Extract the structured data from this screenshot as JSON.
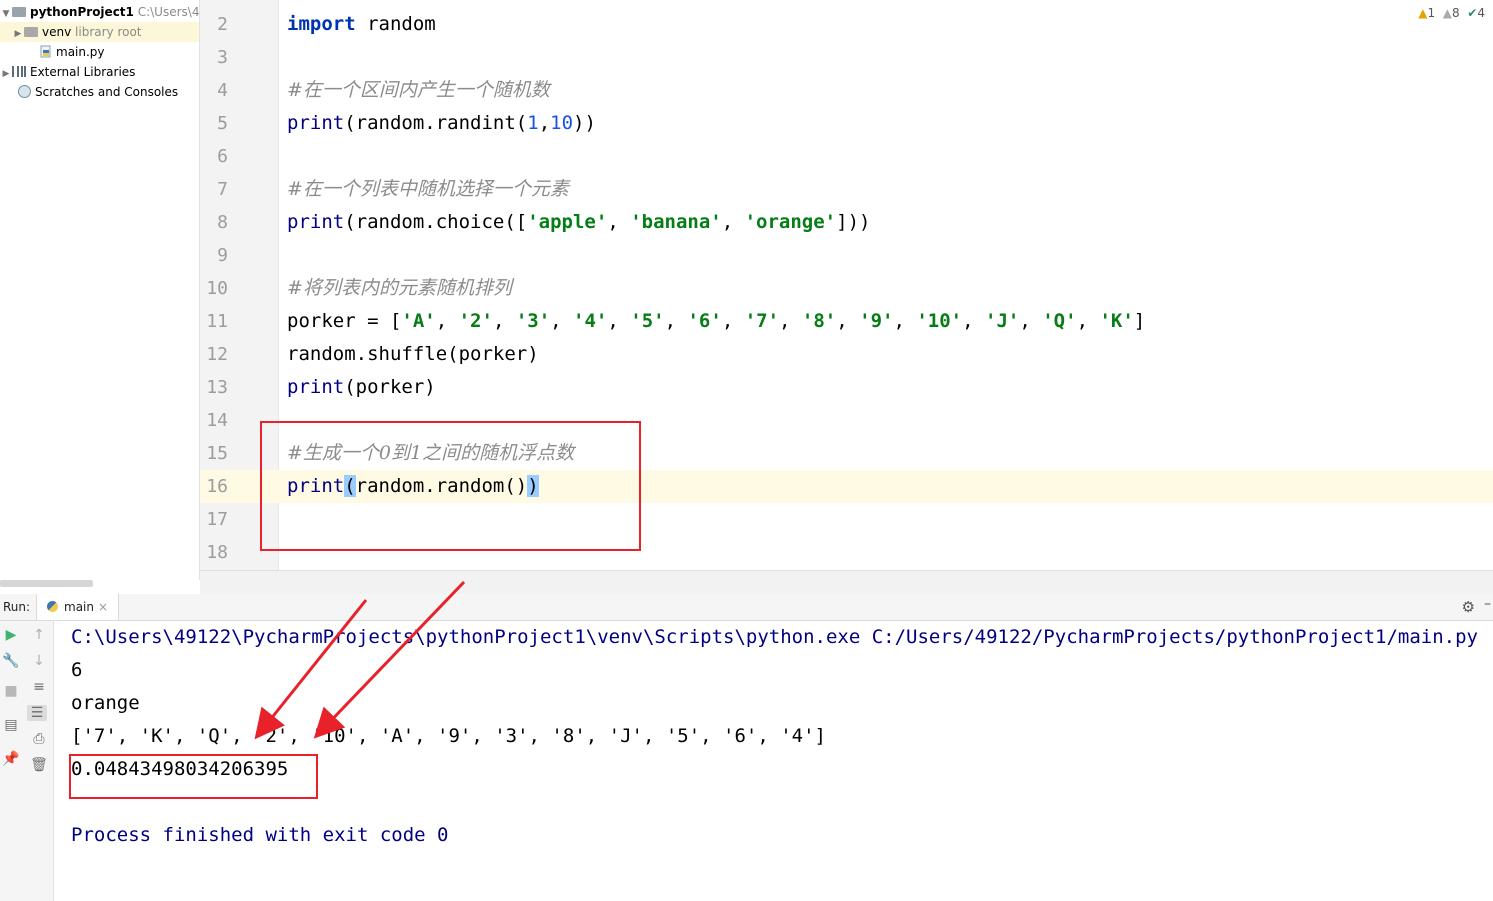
{
  "project_tree": {
    "root_label": "pythonProject1",
    "root_path": "C:\\Users\\4",
    "venv_label": "venv",
    "venv_hint": "library root",
    "file_label": "main.py",
    "external_label": "External Libraries",
    "scratches_label": "Scratches and Consoles"
  },
  "inspection": {
    "warnings": "1",
    "weak_warnings": "8",
    "typos": "4"
  },
  "editor": {
    "line_numbers": [
      "2",
      "3",
      "4",
      "5",
      "6",
      "7",
      "8",
      "9",
      "10",
      "11",
      "12",
      "13",
      "14",
      "15",
      "16",
      "17",
      "18"
    ],
    "lines": {
      "l2_kw": "import",
      "l2_rest": " random",
      "l4": "#在一个区间内产生一个随机数",
      "l5_fn": "print",
      "l5_a": "(random.randint(",
      "l5_n1": "1",
      "l5_comma": ",",
      "l5_n2": "10",
      "l5_close": "))",
      "l7": "#在一个列表中随机选择一个元素",
      "l8_fn": "print",
      "l8_a": "(random.choice([",
      "l8_s1": "'apple'",
      "l8_sep1": ", ",
      "l8_s2": "'banana'",
      "l8_sep2": ", ",
      "l8_s3": "'orange'",
      "l8_close": "]))",
      "l10": "#将列表内的元素随机排列",
      "l11_a": "porker = [",
      "l11_items": [
        "'A'",
        "'2'",
        "'3'",
        "'4'",
        "'5'",
        "'6'",
        "'7'",
        "'8'",
        "'9'",
        "'10'",
        "'J'",
        "'Q'",
        "'K'"
      ],
      "l11_close": "]",
      "l12": "random.shuffle(porker)",
      "l13_fn": "print",
      "l13_rest": "(porker)",
      "l15": "#生成一个0到1之间的随机浮点数",
      "l16_fn": "print",
      "l16_open": "(",
      "l16_mid": "random.random()",
      "l16_close": ")"
    }
  },
  "run_panel": {
    "label": "Run:",
    "tab_name": "main",
    "tab_close": "×",
    "output": [
      "C:\\Users\\49122\\PycharmProjects\\pythonProject1\\venv\\Scripts\\python.exe C:/Users/49122/PycharmProjects/pythonProject1/main.py",
      "6",
      "orange",
      "['7', 'K', 'Q', '2', '10', 'A', '9', '3', '8', 'J', '5', '6', '4']",
      "0.04843498034206395",
      "",
      "Process finished with exit code 0"
    ]
  },
  "colors": {
    "keyword": "#0033b3",
    "string": "#067d17",
    "number": "#1750eb",
    "comment": "#8c8c8c",
    "annotation_red": "#e8212b",
    "current_line": "#fffae3"
  },
  "icons": [
    "folder-icon",
    "python-file-icon",
    "libraries-icon",
    "scratches-icon",
    "warning-icon",
    "weak-warning-icon",
    "typo-check-icon",
    "run-icon",
    "wrench-icon",
    "stop-icon",
    "up-arrow-icon",
    "down-arrow-icon",
    "soft-wrap-icon",
    "scroll-to-end-icon",
    "print-icon",
    "trash-icon",
    "layout-icon",
    "pin-icon",
    "gear-icon",
    "python-tab-icon"
  ]
}
